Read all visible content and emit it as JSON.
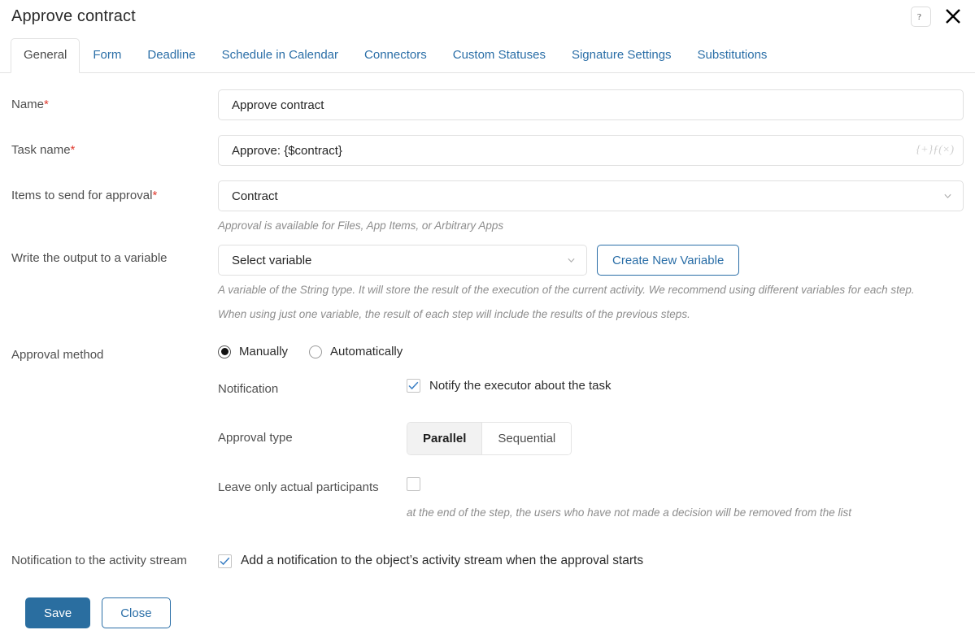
{
  "header": {
    "title": "Approve contract",
    "help_icon": "question-mark-icon",
    "close_icon": "close-icon"
  },
  "tabs": [
    {
      "label": "General",
      "active": true
    },
    {
      "label": "Form",
      "active": false
    },
    {
      "label": "Deadline",
      "active": false
    },
    {
      "label": "Schedule in Calendar",
      "active": false
    },
    {
      "label": "Connectors",
      "active": false
    },
    {
      "label": "Custom Statuses",
      "active": false
    },
    {
      "label": "Signature Settings",
      "active": false
    },
    {
      "label": "Substitutions",
      "active": false
    }
  ],
  "form": {
    "name": {
      "label": "Name",
      "required_mark": "*",
      "value": "Approve contract"
    },
    "task_name": {
      "label": "Task name",
      "required_mark": "*",
      "value": "Approve: {$contract}",
      "insert_variable_icon": "{+}ƒ(×)"
    },
    "items_to_send": {
      "label": "Items to send for approval",
      "required_mark": "*",
      "value": "Contract",
      "hint": "Approval is available for Files, App Items, or Arbitrary Apps"
    },
    "output_variable": {
      "label": "Write the output to a variable",
      "select_value": "Select variable",
      "create_button": "Create New Variable",
      "hint_line_1": "A variable of the String type. It will store the result of the execution of the current activity. We recommend using different variables for each step.",
      "hint_line_2": "When using just one variable, the result of each step will include the results of the previous steps."
    },
    "approval_method": {
      "label": "Approval method",
      "options": [
        {
          "label": "Manually",
          "selected": true
        },
        {
          "label": "Automatically",
          "selected": false
        }
      ],
      "notification": {
        "label": "Notification",
        "checkbox_label": "Notify the executor about the task",
        "checked": true
      },
      "approval_type": {
        "label": "Approval type",
        "options": [
          {
            "label": "Parallel",
            "active": true
          },
          {
            "label": "Sequential",
            "active": false
          }
        ]
      },
      "leave_actual": {
        "label": "Leave only actual participants",
        "checked": false,
        "hint": "at the end of the step, the users who have not made a decision will be removed from the list"
      }
    },
    "activity_stream": {
      "label": "Notification to the activity stream",
      "checkbox_label": "Add a notification to the object’s activity stream when the approval starts",
      "checked": true
    }
  },
  "footer": {
    "save_label": "Save",
    "close_label": "Close"
  },
  "colors": {
    "accent_blue": "#2a6ea7",
    "primary_button": "#2a6ea0",
    "required_red": "#e03b2f",
    "hint_grey": "#8d8d8d",
    "checkmark_blue": "#3b7fc4"
  }
}
